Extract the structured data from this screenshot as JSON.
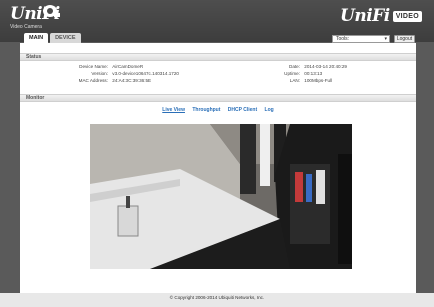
{
  "header": {
    "brand": "UniFi",
    "brand_sub": "Video Camera",
    "right_brand": "UniFi",
    "right_badge": "VIDEO"
  },
  "tabs": [
    {
      "label": "MAIN"
    },
    {
      "label": "DEVICE"
    }
  ],
  "toolbar": {
    "tools_value": "Tools:",
    "logout_label": "Logout"
  },
  "status": {
    "title": "Status",
    "left": [
      {
        "key": "Device Name:",
        "value": "AirCamDomeR"
      },
      {
        "key": "Version:",
        "value": "v3.0-device10647c.140314.1720"
      },
      {
        "key": "MAC Address:",
        "value": "24:A4:3C:39:36:5E"
      }
    ],
    "right": [
      {
        "key": "Date:",
        "value": "2014-03-14 20:40:29"
      },
      {
        "key": "Uptime:",
        "value": "00:13:13"
      },
      {
        "key": "LAN:",
        "value": "100Mbps-Full"
      }
    ]
  },
  "monitor": {
    "title": "Monitor",
    "links": [
      "Live View",
      "Throughput",
      "DHCP Client",
      "Log"
    ]
  },
  "footer": {
    "copyright": "© Copyright 2006-2014 Ubiquiti Networks, Inc."
  },
  "colors": {
    "link": "#2a6fb8",
    "header_bg": "#4a4a4a",
    "page_bg": "#5a5a5a"
  }
}
